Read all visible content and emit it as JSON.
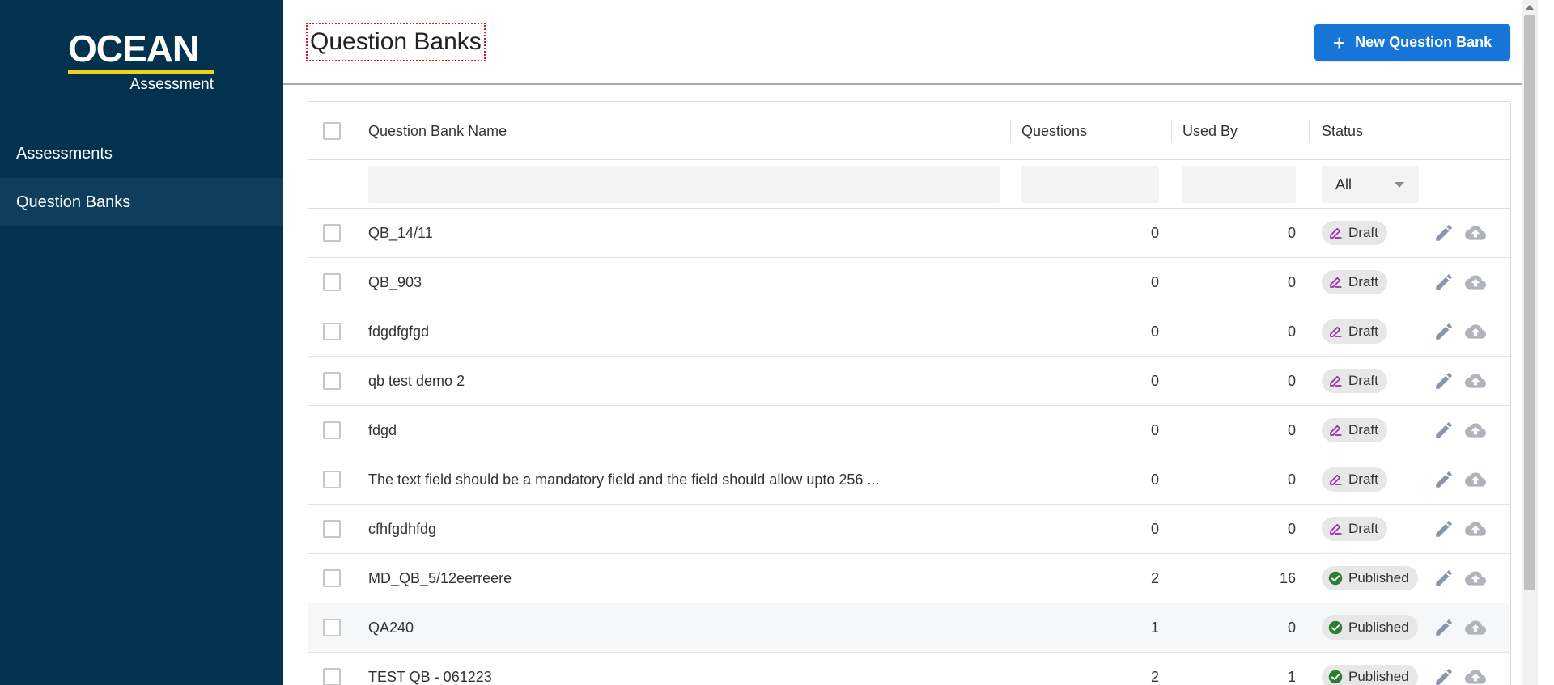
{
  "app": {
    "logo_main": "OCEAN",
    "logo_sub": "Assessment",
    "accent_color": "#f2d21a",
    "sidebar_color": "#03324e",
    "primary_color": "#1675d6"
  },
  "sidebar": {
    "items": [
      {
        "label": "Assessments",
        "active": false
      },
      {
        "label": "Question Banks",
        "active": true
      }
    ]
  },
  "header": {
    "title": "Question Banks",
    "new_button_label": "New Question Bank",
    "new_button_icon": "plus-icon"
  },
  "table": {
    "columns": {
      "name": "Question Bank Name",
      "questions": "Questions",
      "used_by": "Used By",
      "status": "Status"
    },
    "filters": {
      "name": "",
      "questions": "",
      "used_by": "",
      "status": "All"
    },
    "rows": [
      {
        "name": "QB_14/11",
        "questions": "0",
        "used_by": "0",
        "status": "Draft"
      },
      {
        "name": "QB_903",
        "questions": "0",
        "used_by": "0",
        "status": "Draft"
      },
      {
        "name": "fdgdfgfgd",
        "questions": "0",
        "used_by": "0",
        "status": "Draft"
      },
      {
        "name": "qb test demo 2",
        "questions": "0",
        "used_by": "0",
        "status": "Draft"
      },
      {
        "name": "fdgd",
        "questions": "0",
        "used_by": "0",
        "status": "Draft"
      },
      {
        "name": "The text field should be a mandatory field and the field should allow upto 256 ...",
        "questions": "0",
        "used_by": "0",
        "status": "Draft"
      },
      {
        "name": "cfhfgdhfdg",
        "questions": "0",
        "used_by": "0",
        "status": "Draft"
      },
      {
        "name": "MD_QB_5/12eerreere",
        "questions": "2",
        "used_by": "16",
        "status": "Published"
      },
      {
        "name": "QA240",
        "questions": "1",
        "used_by": "0",
        "status": "Published"
      },
      {
        "name": "TEST QB - 061223",
        "questions": "2",
        "used_by": "1",
        "status": "Published"
      }
    ],
    "status_colors": {
      "Draft": "#9c27b0",
      "Published": "#2e7d32"
    },
    "row_actions": [
      "edit-pencil-icon",
      "upload-cloud-icon"
    ]
  }
}
